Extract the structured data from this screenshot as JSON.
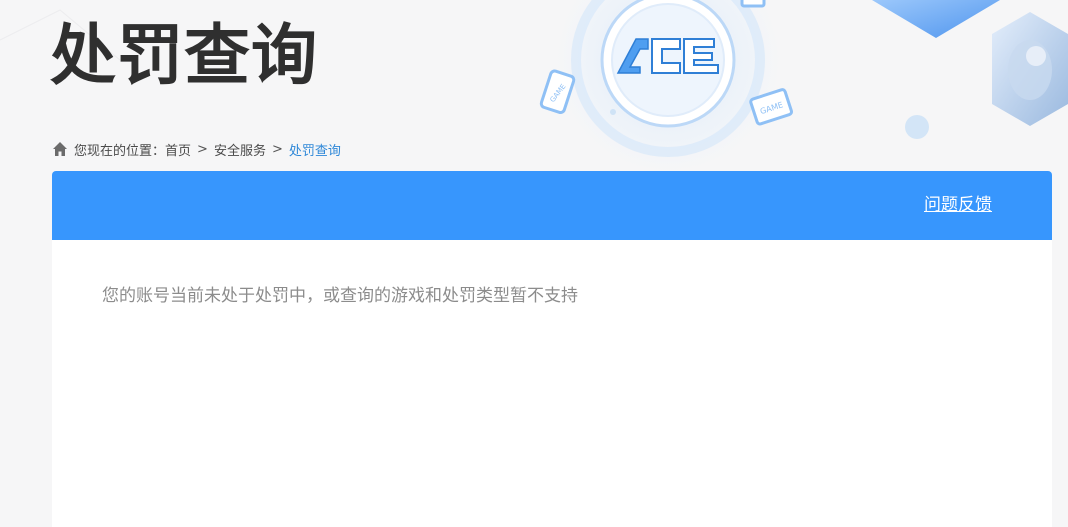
{
  "page": {
    "title": "处罚查询",
    "logo_text": "ACE",
    "device_badge_text": "GAME"
  },
  "breadcrumb": {
    "prefix": "您现在的位置：",
    "items": [
      {
        "label": "首页"
      },
      {
        "label": "安全服务"
      },
      {
        "label": "处罚查询"
      }
    ],
    "separator": ">"
  },
  "panel": {
    "feedback_label": "问题反馈",
    "message": "您的账号当前未处于处罚中，或查询的游戏和处罚类型暂不支持"
  },
  "colors": {
    "accent": "#3796fd",
    "link_current": "#2f88d8",
    "background": "#f6f6f7"
  }
}
